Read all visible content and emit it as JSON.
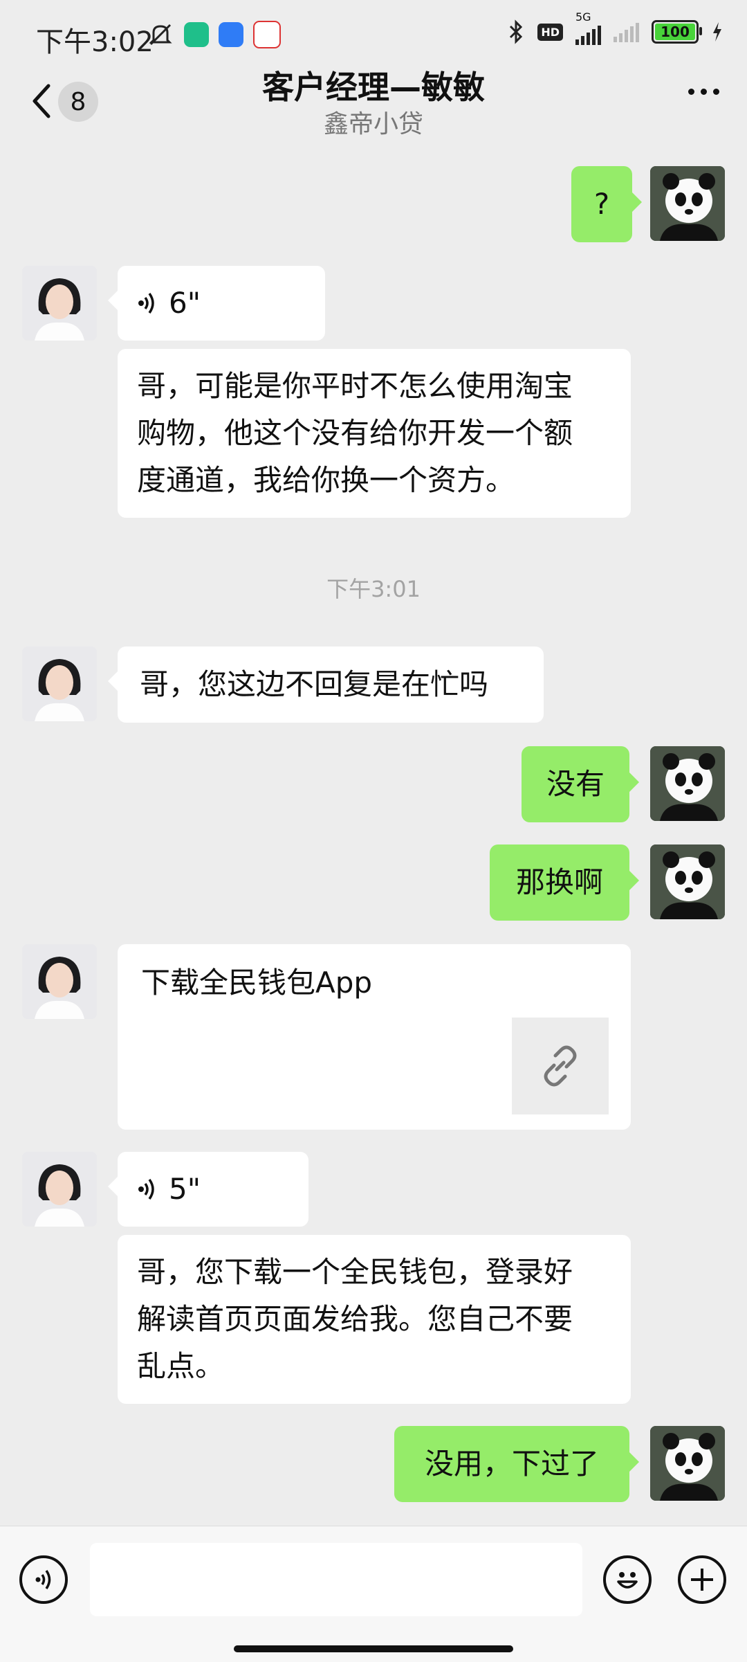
{
  "status_bar": {
    "time": "下午3:02",
    "network": "5G",
    "hd": "HD",
    "battery": "100"
  },
  "header": {
    "back_count": "8",
    "title": "客户经理—敏敏",
    "subtitle": "鑫帝小贷"
  },
  "messages": [
    {
      "from": "me",
      "type": "text",
      "text": "?"
    },
    {
      "from": "agent",
      "type": "voice",
      "duration": "6\""
    },
    {
      "from": "agent",
      "type": "text",
      "lines": [
        "哥，可能是你平时不怎么使用淘宝",
        "购物，他这个没有给你开发一个额",
        "度通道，我给你换一个资方。"
      ]
    },
    {
      "type": "timestamp",
      "text": "下午3:01"
    },
    {
      "from": "agent",
      "type": "text",
      "text": "哥，您这边不回复是在忙吗"
    },
    {
      "from": "me",
      "type": "text",
      "text": "没有"
    },
    {
      "from": "me",
      "type": "text",
      "text": "那换啊"
    },
    {
      "from": "agent",
      "type": "link",
      "text": "下载全民钱包App"
    },
    {
      "from": "agent",
      "type": "voice",
      "duration": "5\""
    },
    {
      "from": "agent",
      "type": "text",
      "lines": [
        "哥，您下载一个全民钱包，登录好",
        "解读首页页面发给我。您自己不要",
        "乱点。"
      ]
    },
    {
      "from": "me",
      "type": "text",
      "text": "没用，下过了"
    }
  ],
  "colors": {
    "background": "#ededed",
    "sent_bubble": "#95ec69",
    "received_bubble": "#ffffff"
  },
  "icons": {
    "back": "chevron-left-icon",
    "more": "more-icon",
    "voice": "voice-icon",
    "emoji": "emoji-icon",
    "plus": "plus-icon",
    "link": "link-icon"
  }
}
